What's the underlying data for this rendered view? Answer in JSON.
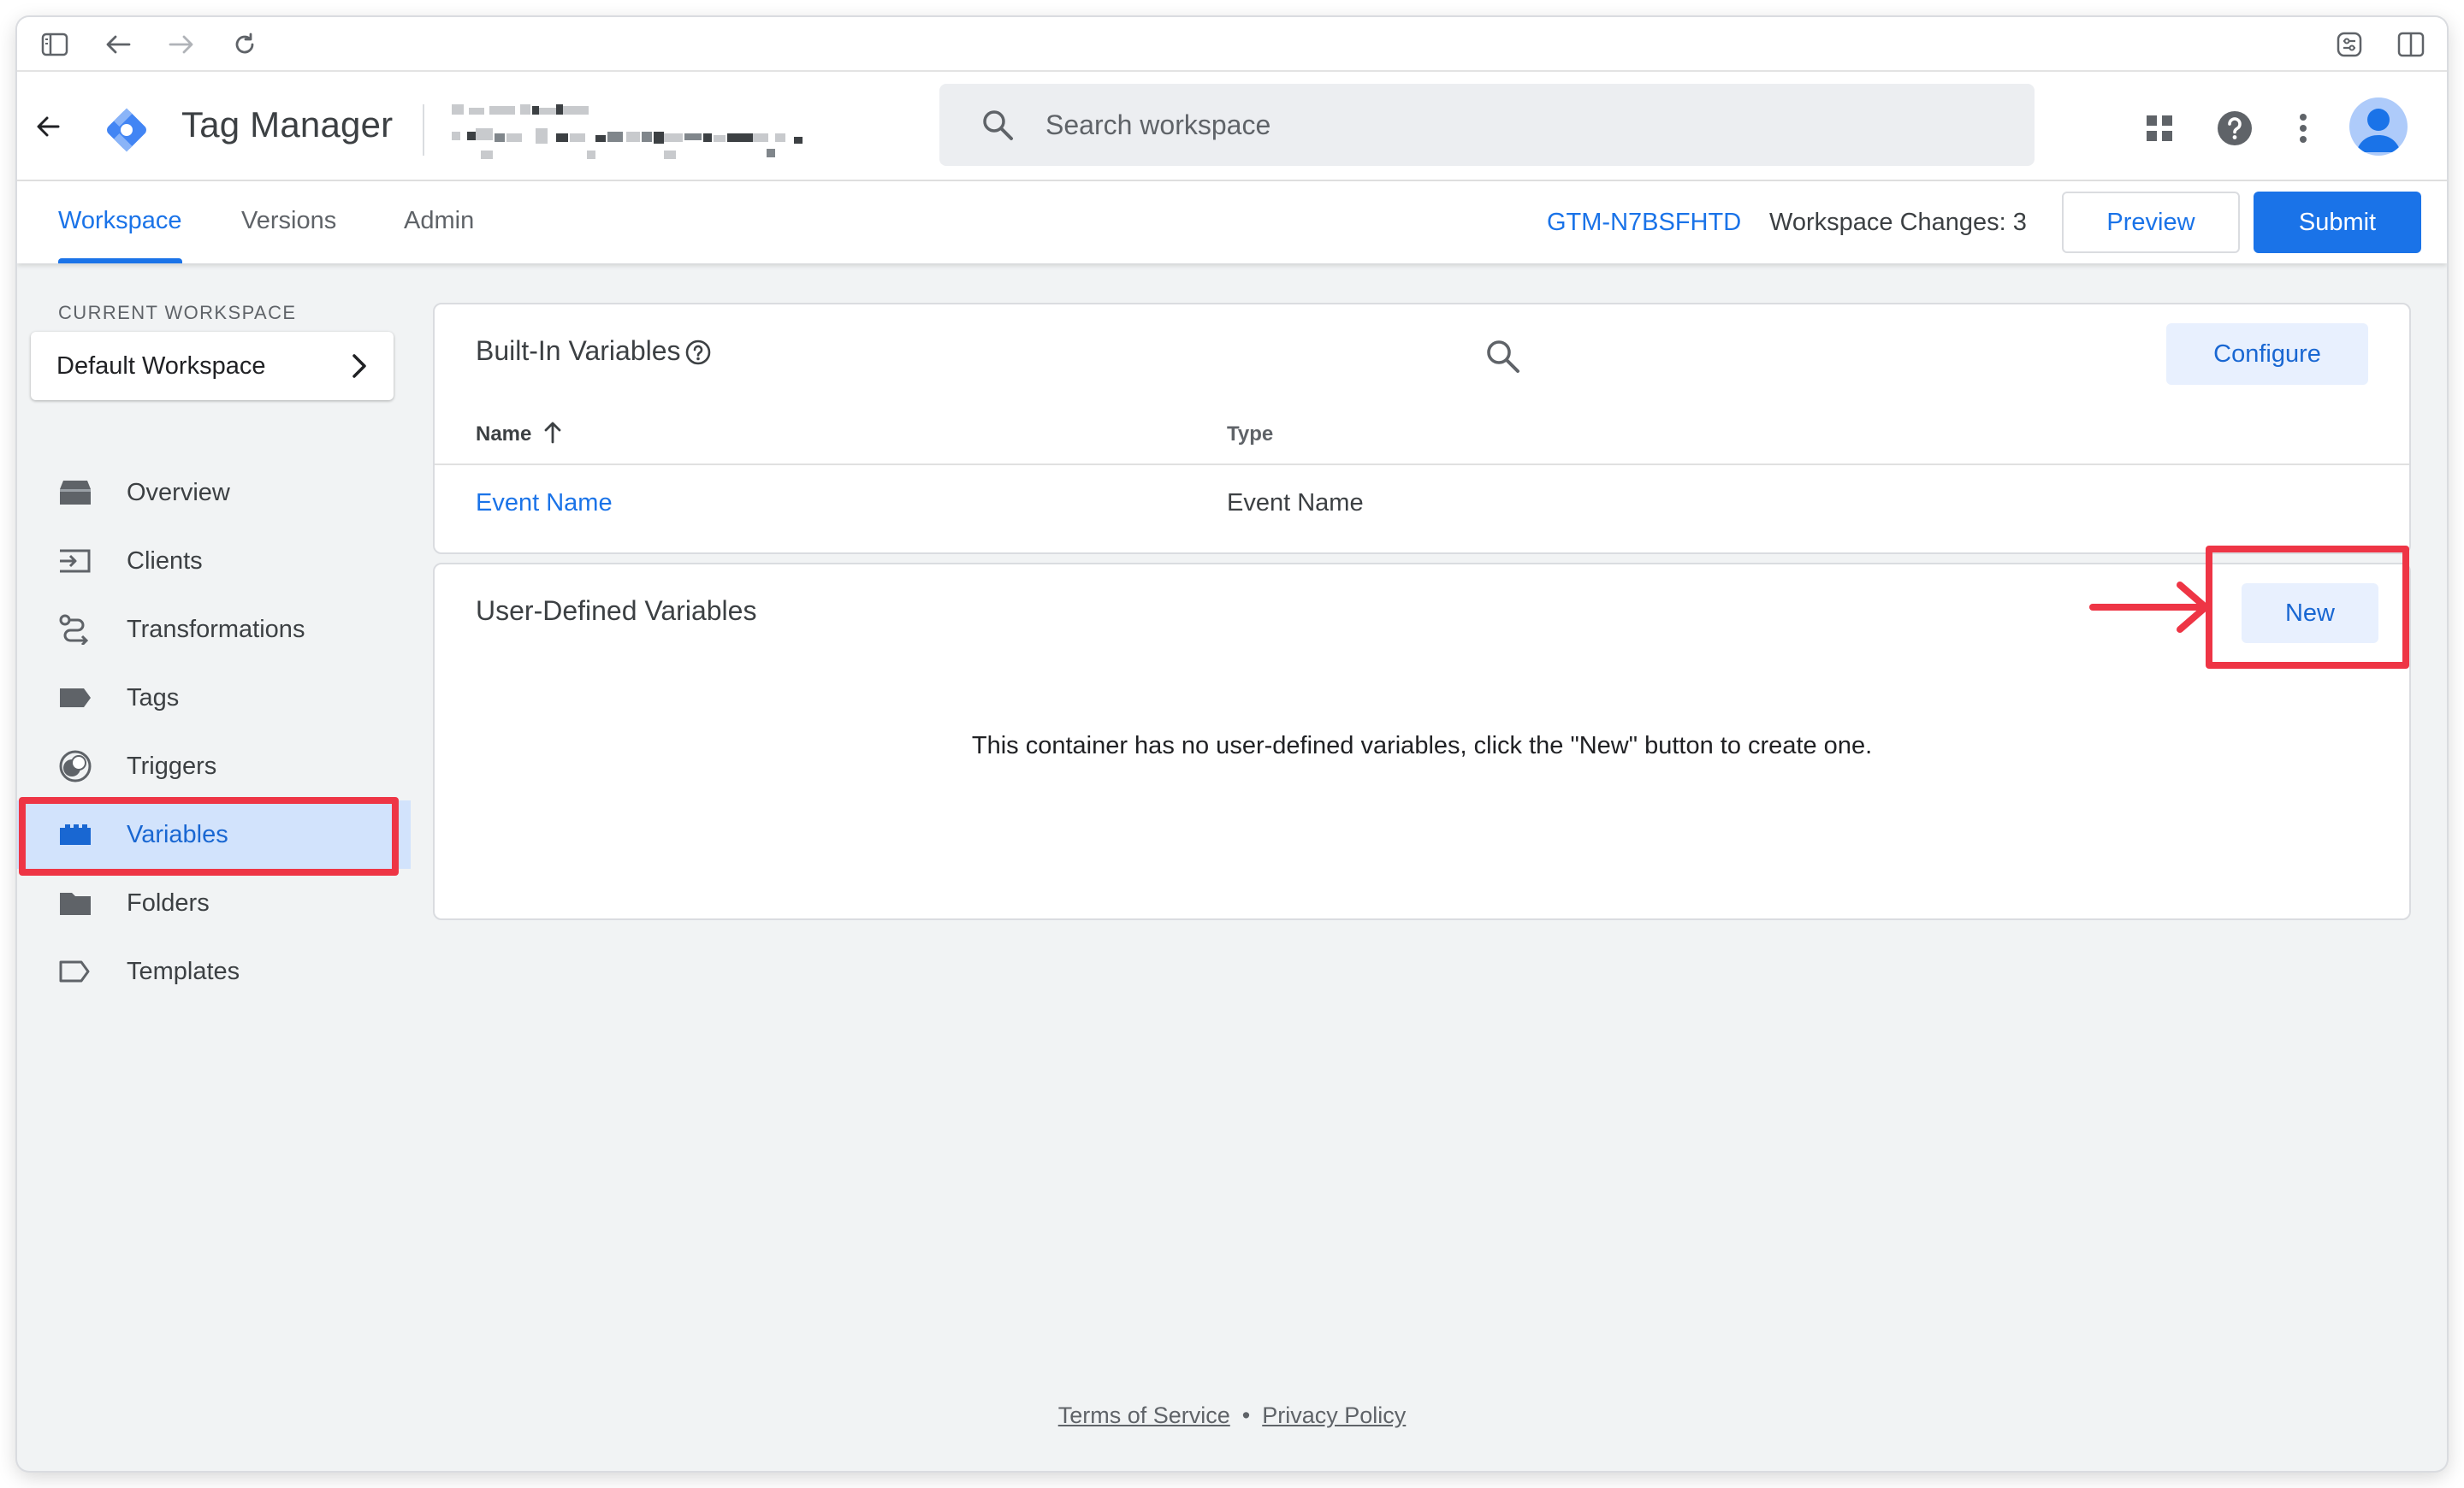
{
  "app": {
    "product_name": "Tag Manager"
  },
  "search": {
    "placeholder": "Search workspace"
  },
  "tabs": [
    {
      "label": "Workspace",
      "active": true
    },
    {
      "label": "Versions",
      "active": false
    },
    {
      "label": "Admin",
      "active": false
    }
  ],
  "container": {
    "id": "GTM-N7BSFHTD",
    "workspace_changes": "Workspace Changes: 3"
  },
  "actions": {
    "preview": "Preview",
    "submit": "Submit"
  },
  "sidebar": {
    "current_workspace_label": "CURRENT WORKSPACE",
    "workspace_name": "Default Workspace",
    "items": [
      {
        "label": "Overview",
        "icon": "overview-icon"
      },
      {
        "label": "Clients",
        "icon": "clients-icon"
      },
      {
        "label": "Transformations",
        "icon": "transformations-icon"
      },
      {
        "label": "Tags",
        "icon": "tag-icon"
      },
      {
        "label": "Triggers",
        "icon": "triggers-icon"
      },
      {
        "label": "Variables",
        "icon": "variables-icon",
        "active": true
      },
      {
        "label": "Folders",
        "icon": "folder-icon"
      },
      {
        "label": "Templates",
        "icon": "templates-icon"
      }
    ]
  },
  "builtin": {
    "title": "Built-In Variables",
    "configure_label": "Configure",
    "columns": {
      "name": "Name",
      "type": "Type"
    },
    "rows": [
      {
        "name": "Event Name",
        "type": "Event Name"
      }
    ]
  },
  "user_defined": {
    "title": "User-Defined Variables",
    "new_label": "New",
    "empty_message": "This container has no user-defined variables, click the \"New\" button to create one."
  },
  "footer": {
    "terms": "Terms of Service",
    "separator": "•",
    "privacy": "Privacy Policy"
  },
  "colors": {
    "accent": "#1a73e8",
    "annotation": "#ee3545",
    "active_nav_bg": "#d2e3fc"
  }
}
